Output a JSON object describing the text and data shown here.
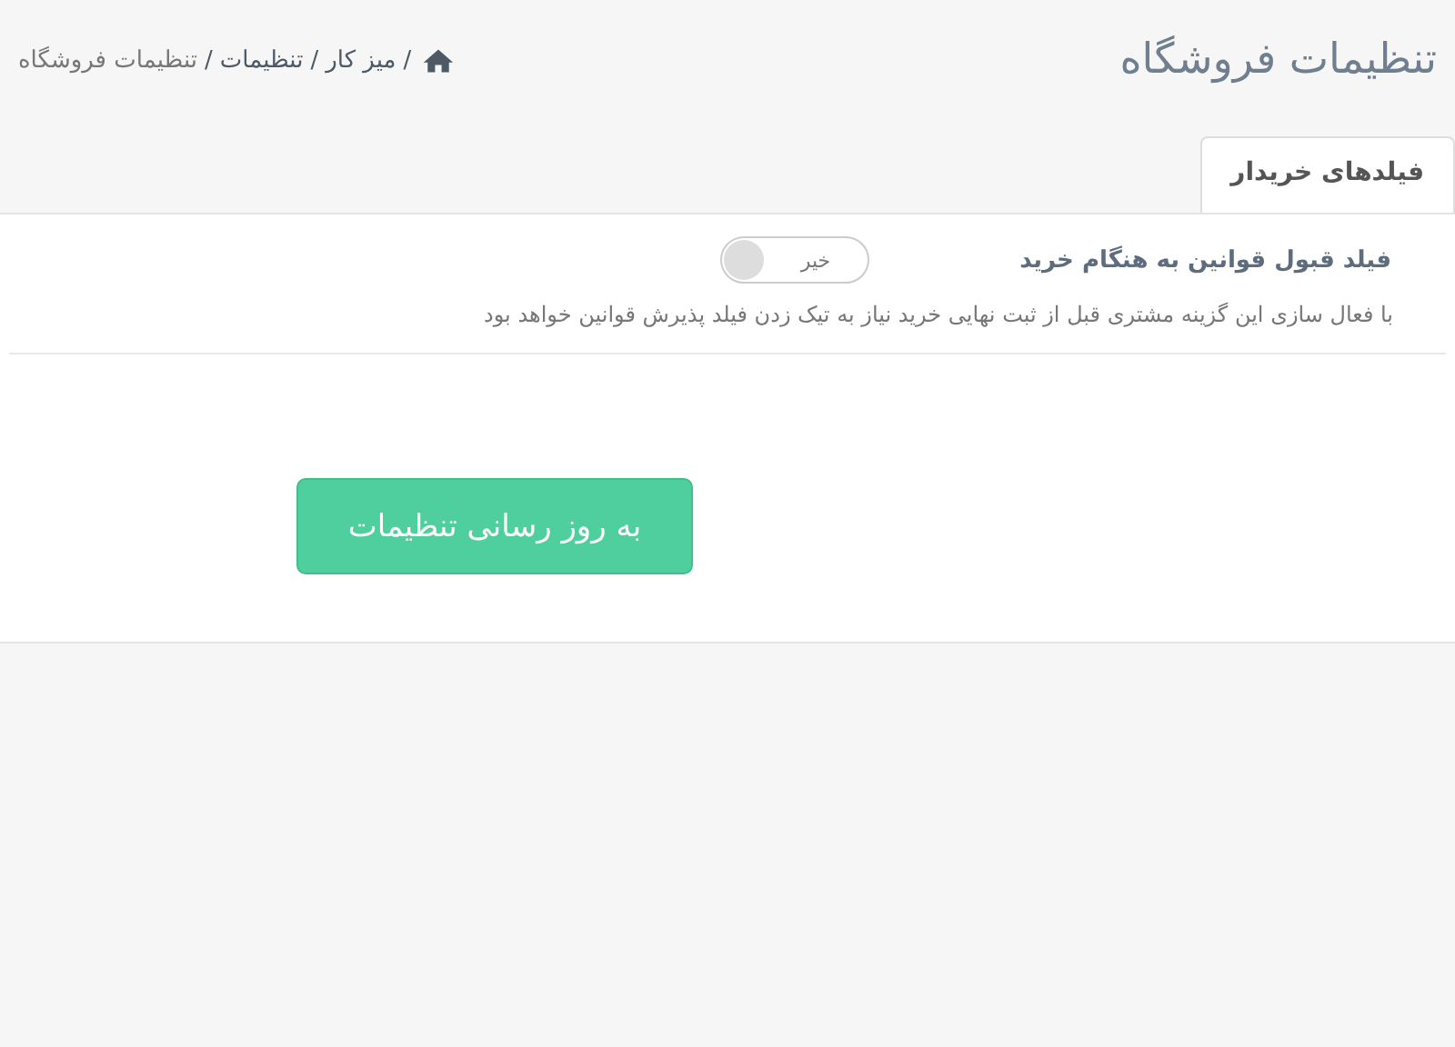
{
  "page_title": "تنظیمات فروشگاه",
  "breadcrumb": [
    {
      "label": "میز کار"
    },
    {
      "label": "تنظیمات"
    },
    {
      "label": "تنظیمات فروشگاه"
    }
  ],
  "breadcrumb_separator": "/",
  "tabs": [
    {
      "label": "فیلدهای خریدار",
      "selected": true
    }
  ],
  "settings": [
    {
      "label": "فیلد قبول قوانین به هنگام خرید",
      "on": false,
      "state_text": "خیر",
      "description": "با فعال سازی این گزینه مشتری قبل از ثبت نهایی خرید نیاز به تیک زدن فیلد پذیرش قوانین خواهد بود"
    }
  ],
  "submit_button": "به روز رسانی تنظیمات"
}
